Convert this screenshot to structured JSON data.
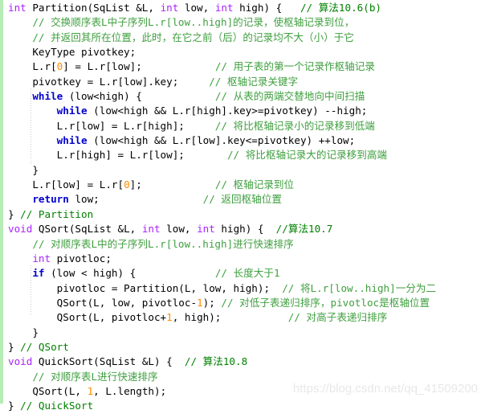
{
  "document": {
    "type": "source-code-snippet",
    "language": "C",
    "left_accent_color": "#b6ecb6",
    "background_color": "#ffffff"
  },
  "syntax_colors": {
    "type_keyword": "#aa22ff",
    "control_keyword": "#0000cd",
    "comment": "#3f9f3f",
    "comment_tail": "#008000",
    "number": "#ff8c00",
    "plain": "#000000"
  },
  "watermark": {
    "text": "https://blog.csdn.net/qq_41509200",
    "color": "#e8e8e8"
  },
  "code": {
    "line_count": 27,
    "lines": [
      {
        "n": 1,
        "tokens": [
          {
            "t": "int",
            "c": "kw-type"
          },
          {
            "t": " Partition(SqList &L, ",
            "c": "plain"
          },
          {
            "t": "int",
            "c": "kw-type"
          },
          {
            "t": " low, ",
            "c": "plain"
          },
          {
            "t": "int",
            "c": "kw-type"
          },
          {
            "t": " high) {   ",
            "c": "plain"
          },
          {
            "t": "// 算法10.6(b)",
            "c": "cmt-dark"
          }
        ]
      },
      {
        "n": 2,
        "tokens": [
          {
            "t": "    ",
            "c": "plain"
          },
          {
            "t": "// 交换顺序表L中子序列L.r[low..high]的记录，使枢轴记录到位，",
            "c": "cmt"
          }
        ]
      },
      {
        "n": 3,
        "tokens": [
          {
            "t": "    ",
            "c": "plain"
          },
          {
            "t": "// 并返回其所在位置，此时，在它之前（后）的记录均不大（小）于它",
            "c": "cmt"
          }
        ]
      },
      {
        "n": 4,
        "tokens": [
          {
            "t": "    KeyType pivotkey;",
            "c": "plain"
          }
        ]
      },
      {
        "n": 5,
        "tokens": [
          {
            "t": "    L.r[",
            "c": "plain"
          },
          {
            "t": "0",
            "c": "num"
          },
          {
            "t": "] = L.r[low];            ",
            "c": "plain"
          },
          {
            "t": "// 用子表的第一个记录作枢轴记录",
            "c": "cmt"
          }
        ]
      },
      {
        "n": 6,
        "tokens": [
          {
            "t": "    pivotkey = L.r[low].key;     ",
            "c": "plain"
          },
          {
            "t": "// 枢轴记录关键字",
            "c": "cmt"
          }
        ]
      },
      {
        "n": 7,
        "tokens": [
          {
            "t": "    ",
            "c": "plain"
          },
          {
            "t": "while",
            "c": "kw-ctrl"
          },
          {
            "t": " (low<high) {            ",
            "c": "plain"
          },
          {
            "t": "// 从表的两端交替地向中间扫描",
            "c": "cmt"
          }
        ]
      },
      {
        "n": 8,
        "tokens": [
          {
            "t": "        ",
            "c": "plain"
          },
          {
            "t": "while",
            "c": "kw-ctrl"
          },
          {
            "t": " (low<high && L.r[high].key>=pivotkey) --high;",
            "c": "plain"
          }
        ]
      },
      {
        "n": 9,
        "tokens": [
          {
            "t": "        L.r[low] = L.r[high];     ",
            "c": "plain"
          },
          {
            "t": "// 将比枢轴记录小的记录移到低端",
            "c": "cmt"
          }
        ]
      },
      {
        "n": 10,
        "tokens": [
          {
            "t": "        ",
            "c": "plain"
          },
          {
            "t": "while",
            "c": "kw-ctrl"
          },
          {
            "t": " (low<high && L.r[low].key<=pivotkey) ++low;",
            "c": "plain"
          }
        ]
      },
      {
        "n": 11,
        "tokens": [
          {
            "t": "        L.r[high] = L.r[low];       ",
            "c": "plain"
          },
          {
            "t": "// 将比枢轴记录大的记录移到高端",
            "c": "cmt"
          }
        ]
      },
      {
        "n": 12,
        "tokens": [
          {
            "t": "    }",
            "c": "plain"
          }
        ]
      },
      {
        "n": 13,
        "tokens": [
          {
            "t": "    L.r[low] = L.r[",
            "c": "plain"
          },
          {
            "t": "0",
            "c": "num"
          },
          {
            "t": "];            ",
            "c": "plain"
          },
          {
            "t": "// 枢轴记录到位",
            "c": "cmt"
          }
        ]
      },
      {
        "n": 14,
        "tokens": [
          {
            "t": "    ",
            "c": "plain"
          },
          {
            "t": "return",
            "c": "kw-ctrl"
          },
          {
            "t": " low;                 ",
            "c": "plain"
          },
          {
            "t": "// 返回枢轴位置",
            "c": "cmt"
          }
        ]
      },
      {
        "n": 15,
        "tokens": [
          {
            "t": "} ",
            "c": "plain"
          },
          {
            "t": "// Partition",
            "c": "cmt-dark"
          }
        ]
      },
      {
        "n": 16,
        "tokens": [
          {
            "t": "void",
            "c": "kw-type"
          },
          {
            "t": " QSort(SqList &L, ",
            "c": "plain"
          },
          {
            "t": "int",
            "c": "kw-type"
          },
          {
            "t": " low, ",
            "c": "plain"
          },
          {
            "t": "int",
            "c": "kw-type"
          },
          {
            "t": " high) {  ",
            "c": "plain"
          },
          {
            "t": "//算法10.7",
            "c": "cmt-dark"
          }
        ]
      },
      {
        "n": 17,
        "tokens": [
          {
            "t": "    ",
            "c": "plain"
          },
          {
            "t": "// 对顺序表L中的子序列L.r[low..high]进行快速排序",
            "c": "cmt"
          }
        ]
      },
      {
        "n": 18,
        "tokens": [
          {
            "t": "    ",
            "c": "plain"
          },
          {
            "t": "int",
            "c": "kw-type"
          },
          {
            "t": " pivotloc;",
            "c": "plain"
          }
        ]
      },
      {
        "n": 19,
        "tokens": [
          {
            "t": "    ",
            "c": "plain"
          },
          {
            "t": "if",
            "c": "kw-ctrl"
          },
          {
            "t": " (low < high) {             ",
            "c": "plain"
          },
          {
            "t": "// 长度大于1",
            "c": "cmt"
          }
        ]
      },
      {
        "n": 20,
        "tokens": [
          {
            "t": "        pivotloc = Partition(L, low, high);  ",
            "c": "plain"
          },
          {
            "t": "// 将L.r[low..high]一分为二",
            "c": "cmt"
          }
        ]
      },
      {
        "n": 21,
        "tokens": [
          {
            "t": "        QSort(L, low, pivotloc-",
            "c": "plain"
          },
          {
            "t": "1",
            "c": "num"
          },
          {
            "t": "); ",
            "c": "plain"
          },
          {
            "t": "// 对低子表递归排序，pivotloc是枢轴位置",
            "c": "cmt"
          }
        ]
      },
      {
        "n": 22,
        "tokens": [
          {
            "t": "        QSort(L, pivotloc+",
            "c": "plain"
          },
          {
            "t": "1",
            "c": "num"
          },
          {
            "t": ", high);           ",
            "c": "plain"
          },
          {
            "t": "// 对高子表递归排序",
            "c": "cmt"
          }
        ]
      },
      {
        "n": 23,
        "tokens": [
          {
            "t": "    }",
            "c": "plain"
          }
        ]
      },
      {
        "n": 24,
        "tokens": [
          {
            "t": "} ",
            "c": "plain"
          },
          {
            "t": "// QSort",
            "c": "cmt-dark"
          }
        ]
      },
      {
        "n": 25,
        "tokens": [
          {
            "t": "void",
            "c": "kw-type"
          },
          {
            "t": " QuickSort(SqList &L) {  ",
            "c": "plain"
          },
          {
            "t": "// 算法10.8",
            "c": "cmt-dark"
          }
        ]
      },
      {
        "n": 26,
        "tokens": [
          {
            "t": "    ",
            "c": "plain"
          },
          {
            "t": "// 对顺序表L进行快速排序",
            "c": "cmt"
          }
        ]
      },
      {
        "n": 27,
        "tokens": [
          {
            "t": "    QSort(L, ",
            "c": "plain"
          },
          {
            "t": "1",
            "c": "num"
          },
          {
            "t": ", L.length);",
            "c": "plain"
          }
        ]
      },
      {
        "n": 28,
        "tokens": [
          {
            "t": "} ",
            "c": "plain"
          },
          {
            "t": "// QuickSort",
            "c": "cmt-dark"
          }
        ]
      }
    ]
  }
}
